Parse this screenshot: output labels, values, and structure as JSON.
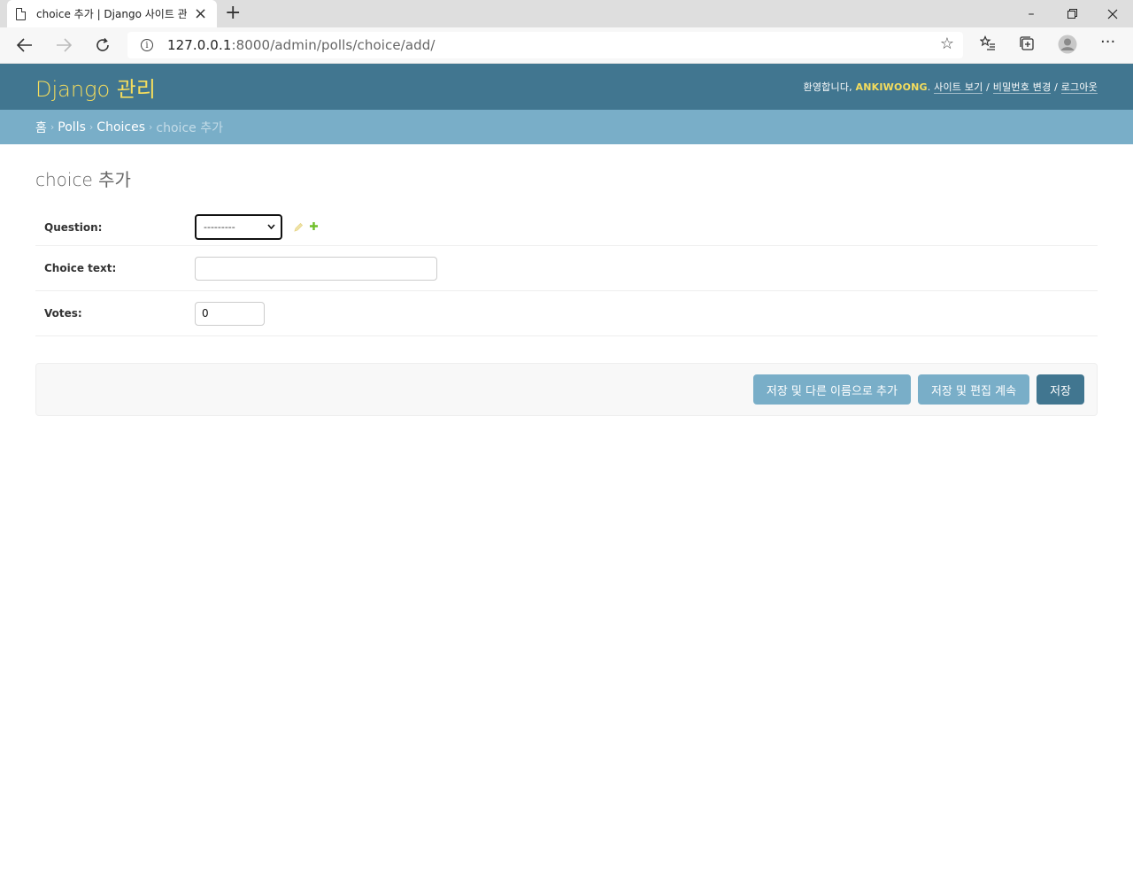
{
  "browser": {
    "tab_title": "choice 추가 | Django 사이트 관리",
    "url_host": "127.0.0.1",
    "url_rest": ":8000/admin/polls/choice/add/"
  },
  "header": {
    "brand": "Django 관리",
    "welcome": "환영합니다,",
    "username": "ANKIWOONG",
    "view_site": "사이트 보기",
    "change_password": "비밀번호 변경",
    "logout": "로그아웃"
  },
  "breadcrumbs": {
    "home": "홈",
    "app": "Polls",
    "model": "Choices",
    "current": "choice 추가"
  },
  "page": {
    "title": "choice 추가"
  },
  "form": {
    "question_label": "Question:",
    "question_selected": "---------",
    "choice_text_label": "Choice text:",
    "choice_text_value": "",
    "votes_label": "Votes:",
    "votes_value": "0"
  },
  "submit": {
    "save_add_another": "저장 및 다른 이름으로 추가",
    "save_continue": "저장 및 편집 계속",
    "save": "저장"
  },
  "colors": {
    "header_bg": "#417690",
    "breadcrumb_bg": "#79aec8",
    "brand": "#f5dd5d",
    "add_icon": "#70bf2b"
  }
}
